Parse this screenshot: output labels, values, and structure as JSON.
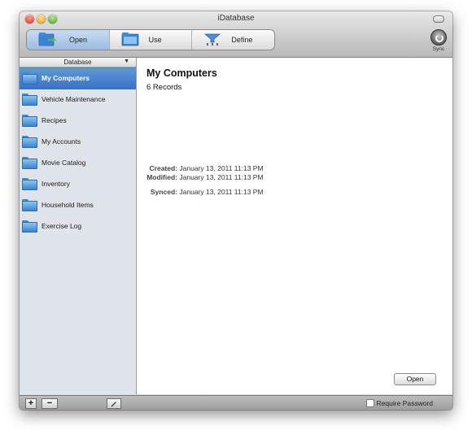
{
  "window": {
    "title": "iDatabase"
  },
  "toolbar": {
    "segments": [
      {
        "label": "Open",
        "icon": "open-folder-icon",
        "active": true
      },
      {
        "label": "Use",
        "icon": "folder-icon",
        "active": false
      },
      {
        "label": "Define",
        "icon": "define-funnel-icon",
        "active": false
      }
    ],
    "sync_label": "Sync"
  },
  "sidebar": {
    "header": "Database",
    "items": [
      {
        "label": "My Computers",
        "selected": true
      },
      {
        "label": "Vehicle Maintenance"
      },
      {
        "label": "Recipes"
      },
      {
        "label": "My Accounts"
      },
      {
        "label": "Movie Catalog"
      },
      {
        "label": "Inventory"
      },
      {
        "label": "Household Items"
      },
      {
        "label": "Exercise Log"
      }
    ]
  },
  "detail": {
    "title": "My Computers",
    "records": "6 Records",
    "created_label": "Created:",
    "created_value": "January 13, 2011 11:13 PM",
    "modified_label": "Modified:",
    "modified_value": "January 13, 2011 11:13 PM",
    "synced_label": "Synced:",
    "synced_value": "January 13, 2011 11:13 PM",
    "open_button": "Open"
  },
  "bottom": {
    "add": "+",
    "remove": "−",
    "require_password": "Require Password"
  },
  "colors": {
    "selection": "#3a70c2",
    "sidebar_bg": "#dfe4ea",
    "folder": "#3a84cf"
  }
}
